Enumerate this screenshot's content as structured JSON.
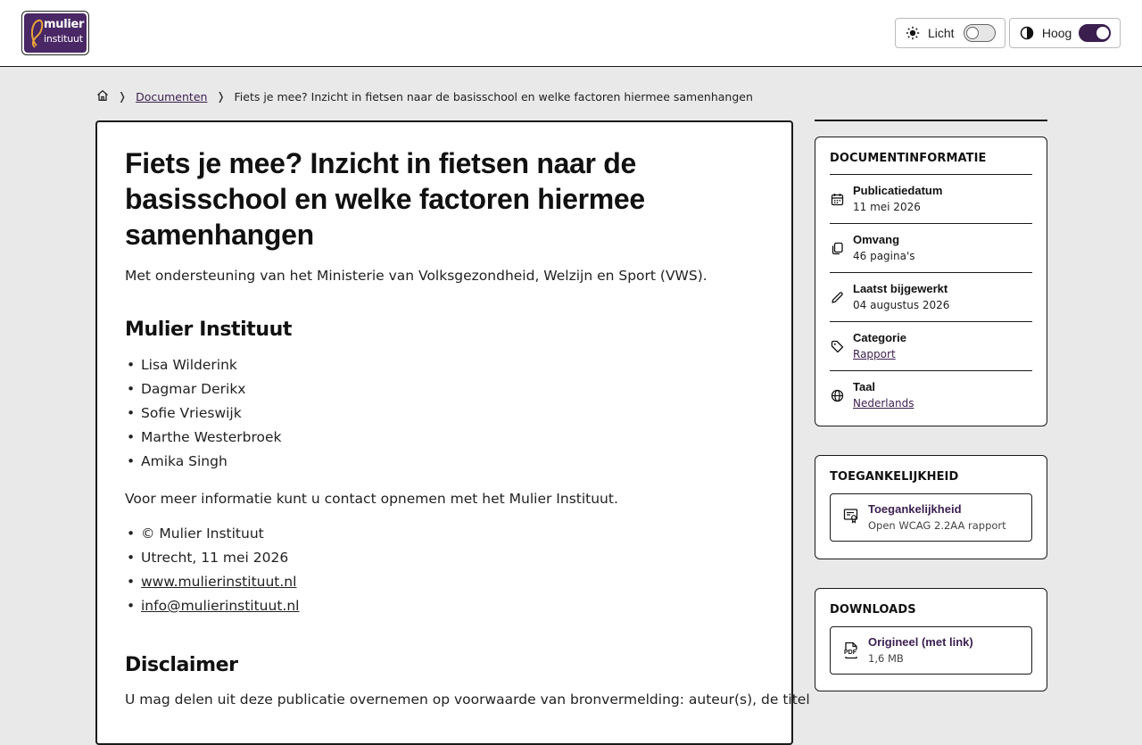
{
  "header": {
    "logo_line1": "mulier",
    "logo_line2": "instituut",
    "toggles": [
      {
        "label": "Licht",
        "on": false
      },
      {
        "label": "Hoog",
        "on": true
      }
    ]
  },
  "breadcrumb": {
    "items": [
      "Documenten",
      "Fiets je mee? Inzicht in fietsen naar de basisschool en welke factoren hiermee samenhangen"
    ]
  },
  "main": {
    "title": "Fiets je mee? Inzicht in fietsen naar de basisschool en welke factoren hiermee samenhangen",
    "subtitle": "Met ondersteuning van het Ministerie van Volksgezondheid, Welzijn en Sport (VWS).",
    "section1_heading": "Mulier Instituut",
    "authors": [
      "Lisa Wilderink",
      "Dagmar Derikx",
      "Sofie Vrieswijk",
      "Marthe Westerbroek",
      "Amika Singh"
    ],
    "contact_text": "Voor meer informatie kunt u contact opnemen met het Mulier Instituut.",
    "meta_list": [
      "© Mulier Instituut",
      "Utrecht, 11 mei 2026",
      "www.mulierinstituut.nl",
      "info@mulierinstituut.nl"
    ],
    "section2_heading": "Disclaimer",
    "disclaimer_text": "U mag delen uit deze publicatie overnemen op voorwaarde van bronvermelding: auteur(s), de titel"
  },
  "sidebar": {
    "docinfo_title": "DOCUMENTINFORMATIE",
    "docinfo": [
      {
        "label": "Publicatiedatum",
        "value": "11 mei 2026",
        "icon": "calendar-icon"
      },
      {
        "label": "Omvang",
        "value": "46 pagina's",
        "icon": "pages-icon"
      },
      {
        "label": "Laatst bijgewerkt",
        "value": "04 augustus 2026",
        "icon": "pencil-icon"
      },
      {
        "label": "Categorie",
        "value": "Rapport",
        "icon": "tag-icon"
      },
      {
        "label": "Taal",
        "value": "Nederlands",
        "icon": "globe-icon"
      }
    ],
    "access_title": "TOEGANKELIJKHEID",
    "access_card": {
      "title": "Toegankelijkheid",
      "subtitle": "Open WCAG 2.2AA rapport"
    },
    "downloads_title": "DOWNLOADS",
    "download_card": {
      "title": "Origineel (met link)",
      "subtitle": "1,6 MB",
      "icon_text": "PDF"
    }
  }
}
